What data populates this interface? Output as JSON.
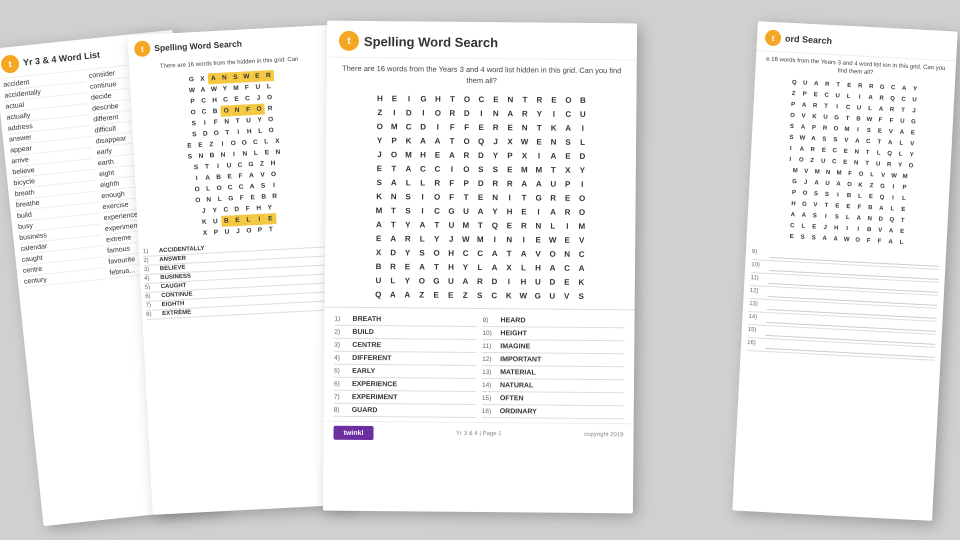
{
  "scene": {
    "bg_color": "#d0d0d0"
  },
  "wordlist": {
    "logo_text": "t",
    "header_title": "Yr 3 & 4 Word List",
    "words_col1": [
      "accident",
      "accidentally",
      "actual",
      "actually",
      "address",
      "answer",
      "appear",
      "arrive",
      "believe",
      "bicycle",
      "breath",
      "breathe",
      "build",
      "busy",
      "business",
      "calendar",
      "caught",
      "centre",
      "century"
    ],
    "words_col2": [
      "consider",
      "continue",
      "decide",
      "describe",
      "different",
      "difficult",
      "disappear",
      "early",
      "earth",
      "eight",
      "eighth",
      "enough",
      "exercise",
      "experience",
      "experiment",
      "extreme",
      "famous",
      "favourite",
      "februa..."
    ]
  },
  "search2": {
    "logo_text": "t",
    "title": "Spelling Word Search",
    "subtitle": "There are 16 words from the\nhidden in this grid. Can",
    "answers": [
      {
        "num": "1)",
        "word": "ACCIDENTALLY"
      },
      {
        "num": "2)",
        "word": "ANSWER"
      },
      {
        "num": "3)",
        "word": "BELIEVE"
      },
      {
        "num": "4)",
        "word": "BUSINESS"
      },
      {
        "num": "5)",
        "word": "CAUGHT"
      },
      {
        "num": "6)",
        "word": "CONTINUE"
      },
      {
        "num": "7)",
        "word": "EIGHTH"
      },
      {
        "num": "8)",
        "word": "EXTRÈME"
      }
    ],
    "grid": [
      [
        "G",
        "X",
        "A",
        "N",
        "S",
        "W",
        "E",
        "R"
      ],
      [
        "W",
        "A",
        "W",
        "Y",
        "M",
        "F",
        "U",
        "L"
      ],
      [
        "P",
        "C",
        "H",
        "C",
        "E",
        "C",
        "J",
        "O"
      ],
      [
        "O",
        "C",
        "B",
        "O",
        "N",
        "F",
        "O",
        "R"
      ],
      [
        "S",
        "I",
        "F",
        "N",
        "T",
        "U",
        "Y",
        "O"
      ],
      [
        "S",
        "D",
        "O",
        "T",
        "I",
        "H",
        "L",
        "O"
      ],
      [
        "E",
        "E",
        "Z",
        "I",
        "O",
        "O",
        "C",
        "L",
        "X"
      ],
      [
        "S",
        "N",
        "B",
        "N",
        "I",
        "N",
        "L",
        "E",
        "N"
      ],
      [
        "S",
        "T",
        "I",
        "U",
        "C",
        "G",
        "Z",
        "H"
      ],
      [
        "I",
        "A",
        "B",
        "E",
        "F",
        "A",
        "V",
        "O"
      ],
      [
        "O",
        "L",
        "O",
        "C",
        "C",
        "A",
        "S",
        "I"
      ],
      [
        "O",
        "N",
        "L",
        "G",
        "F",
        "E",
        "B",
        "R"
      ],
      [
        "J",
        "Y",
        "C",
        "D",
        "F",
        "H",
        "Y"
      ],
      [
        "K",
        "U",
        "B",
        "E",
        "L",
        "I",
        "E"
      ],
      [
        "X",
        "P",
        "U",
        "J",
        "O",
        "P",
        "T"
      ]
    ]
  },
  "main": {
    "logo_text": "t",
    "title": "Spelling Word Search",
    "subtitle": "There are 16 words from the Years 3 and 4 word list\nhidden in this grid. Can you find them all?",
    "footer_page": "Yr 3 & 4 | Page 1",
    "footer_copy": "copyright 2019",
    "answers_left": [
      {
        "num": "1)",
        "word": "BREATH"
      },
      {
        "num": "2)",
        "word": "BUILD"
      },
      {
        "num": "3)",
        "word": "CENTRE"
      },
      {
        "num": "4)",
        "word": "DIFFERENT"
      },
      {
        "num": "5)",
        "word": "EARLY"
      },
      {
        "num": "6)",
        "word": "EXPERIENCE"
      },
      {
        "num": "7)",
        "word": "EXPERIMENT"
      },
      {
        "num": "8)",
        "word": "GUARD"
      }
    ],
    "answers_right": [
      {
        "num": "9)",
        "word": "HEARD"
      },
      {
        "num": "10)",
        "word": "HEIGHT"
      },
      {
        "num": "11)",
        "word": "IMAGINE"
      },
      {
        "num": "12)",
        "word": "IMPORTANT"
      },
      {
        "num": "13)",
        "word": "MATERIAL"
      },
      {
        "num": "14)",
        "word": "NATURAL"
      },
      {
        "num": "15)",
        "word": "OFTEN"
      },
      {
        "num": "16)",
        "word": "ORDINARY"
      }
    ],
    "grid": [
      [
        "H",
        "E",
        "I",
        "G",
        "H",
        "T",
        "O",
        "C",
        "E",
        "N",
        "T",
        "R",
        "E",
        "O",
        "B"
      ],
      [
        "Z",
        "I",
        "D",
        "I",
        "O",
        "R",
        "D",
        "I",
        "N",
        "A",
        "R",
        "Y",
        "I",
        "C",
        "U"
      ],
      [
        "O",
        "M",
        "C",
        "D",
        "I",
        "F",
        "F",
        "E",
        "R",
        "E",
        "N",
        "T",
        "K",
        "A",
        "I"
      ],
      [
        "Y",
        "P",
        "K",
        "A",
        "A",
        "T",
        "O",
        "Q",
        "J",
        "X",
        "W",
        "E",
        "N",
        "S",
        "L"
      ],
      [
        "J",
        "O",
        "M",
        "H",
        "E",
        "A",
        "R",
        "D",
        "Y",
        "P",
        "X",
        "I",
        "A",
        "E",
        "D"
      ],
      [
        "E",
        "T",
        "A",
        "C",
        "C",
        "I",
        "O",
        "S",
        "S",
        "E",
        "M",
        "M",
        "T",
        "X",
        "Y"
      ],
      [
        "S",
        "A",
        "L",
        "L",
        "R",
        "F",
        "P",
        "D",
        "R",
        "R",
        "A",
        "A",
        "U",
        "P",
        "I"
      ],
      [
        "K",
        "N",
        "S",
        "I",
        "O",
        "F",
        "T",
        "E",
        "N",
        "I",
        "T",
        "G",
        "R",
        "E",
        "O"
      ],
      [
        "M",
        "T",
        "S",
        "I",
        "C",
        "G",
        "U",
        "A",
        "Y",
        "H",
        "E",
        "I",
        "A",
        "R",
        "O"
      ],
      [
        "A",
        "T",
        "Y",
        "A",
        "T",
        "U",
        "M",
        "T",
        "Q",
        "E",
        "R",
        "N",
        "L",
        "I",
        "M"
      ],
      [
        "E",
        "A",
        "R",
        "L",
        "Y",
        "J",
        "W",
        "M",
        "I",
        "N",
        "I",
        "E",
        "W",
        "E",
        "V"
      ],
      [
        "X",
        "D",
        "Y",
        "S",
        "O",
        "H",
        "C",
        "C",
        "A",
        "T",
        "A",
        "V",
        "O",
        "N",
        "C"
      ],
      [
        "B",
        "R",
        "E",
        "A",
        "T",
        "H",
        "Y",
        "L",
        "A",
        "X",
        "L",
        "H",
        "A",
        "C",
        "A"
      ],
      [
        "U",
        "L",
        "Y",
        "O",
        "G",
        "U",
        "A",
        "R",
        "D",
        "I",
        "H",
        "U",
        "D",
        "E",
        "K"
      ],
      [
        "Q",
        "A",
        "A",
        "Z",
        "E",
        "E",
        "Z",
        "S",
        "C",
        "K",
        "W",
        "G",
        "U",
        "V",
        "S"
      ]
    ]
  },
  "right": {
    "logo_text": "t",
    "title": "ord Search",
    "subtitle": "e 16 words from the Years 3 and 4 word list\nion in this grid. Can you find them all?",
    "answers": [
      {
        "num": "9)"
      },
      {
        "num": "10)"
      },
      {
        "num": "11)"
      },
      {
        "num": "12)"
      },
      {
        "num": "13)"
      },
      {
        "num": "14)"
      },
      {
        "num": "15)"
      },
      {
        "num": "16)"
      }
    ],
    "grid": [
      [
        "Q",
        "U",
        "A",
        "R",
        "T",
        "E",
        "R",
        "R",
        "G",
        "C",
        "A",
        "Y"
      ],
      [
        "Z",
        "P",
        "E",
        "C",
        "U",
        "L",
        "I",
        "A",
        "R",
        "Q",
        "C",
        "U"
      ],
      [
        "P",
        "A",
        "R",
        "T",
        "I",
        "C",
        "U",
        "L",
        "A",
        "R",
        "T",
        "J"
      ],
      [
        "O",
        "V",
        "K",
        "U",
        "G",
        "T",
        "B",
        "W",
        "F",
        "F",
        "U",
        "G"
      ],
      [
        "S",
        "A",
        "P",
        "R",
        "O",
        "M",
        "I",
        "S",
        "E",
        "V",
        "A",
        "E"
      ],
      [
        "S",
        "W",
        "A",
        "S",
        "S",
        "V",
        "A",
        "C",
        "T",
        "A",
        "L",
        "V"
      ],
      [
        "I",
        "A",
        "R",
        "E",
        "C",
        "E",
        "N",
        "T",
        "L",
        "Q",
        "L",
        "Y"
      ],
      [
        "I",
        "O",
        "Z",
        "U",
        "C",
        "E",
        "N",
        "T",
        "U",
        "R",
        "Y",
        "O"
      ],
      [
        "M",
        "V",
        "M",
        "N",
        "M",
        "F",
        "O",
        "L",
        "V",
        "W",
        "M"
      ],
      [
        "G",
        "J",
        "A",
        "U",
        "A",
        "O",
        "K",
        "Z",
        "G",
        "I",
        "P"
      ],
      [
        "P",
        "O",
        "S",
        "S",
        "I",
        "B",
        "L",
        "E",
        "Q",
        "I",
        "L"
      ],
      [
        "H",
        "G",
        "V",
        "T",
        "E",
        "E",
        "F",
        "B",
        "A",
        "L",
        "E"
      ],
      [
        "A",
        "A",
        "S",
        "I",
        "S",
        "L",
        "A",
        "N",
        "D",
        "Q",
        "T"
      ],
      [
        "C",
        "L",
        "E",
        "J",
        "H",
        "I",
        "I",
        "B",
        "V",
        "A",
        "E"
      ],
      [
        "E",
        "S",
        "S",
        "A",
        "A",
        "W",
        "O",
        "F",
        "F",
        "A",
        "L"
      ]
    ]
  }
}
